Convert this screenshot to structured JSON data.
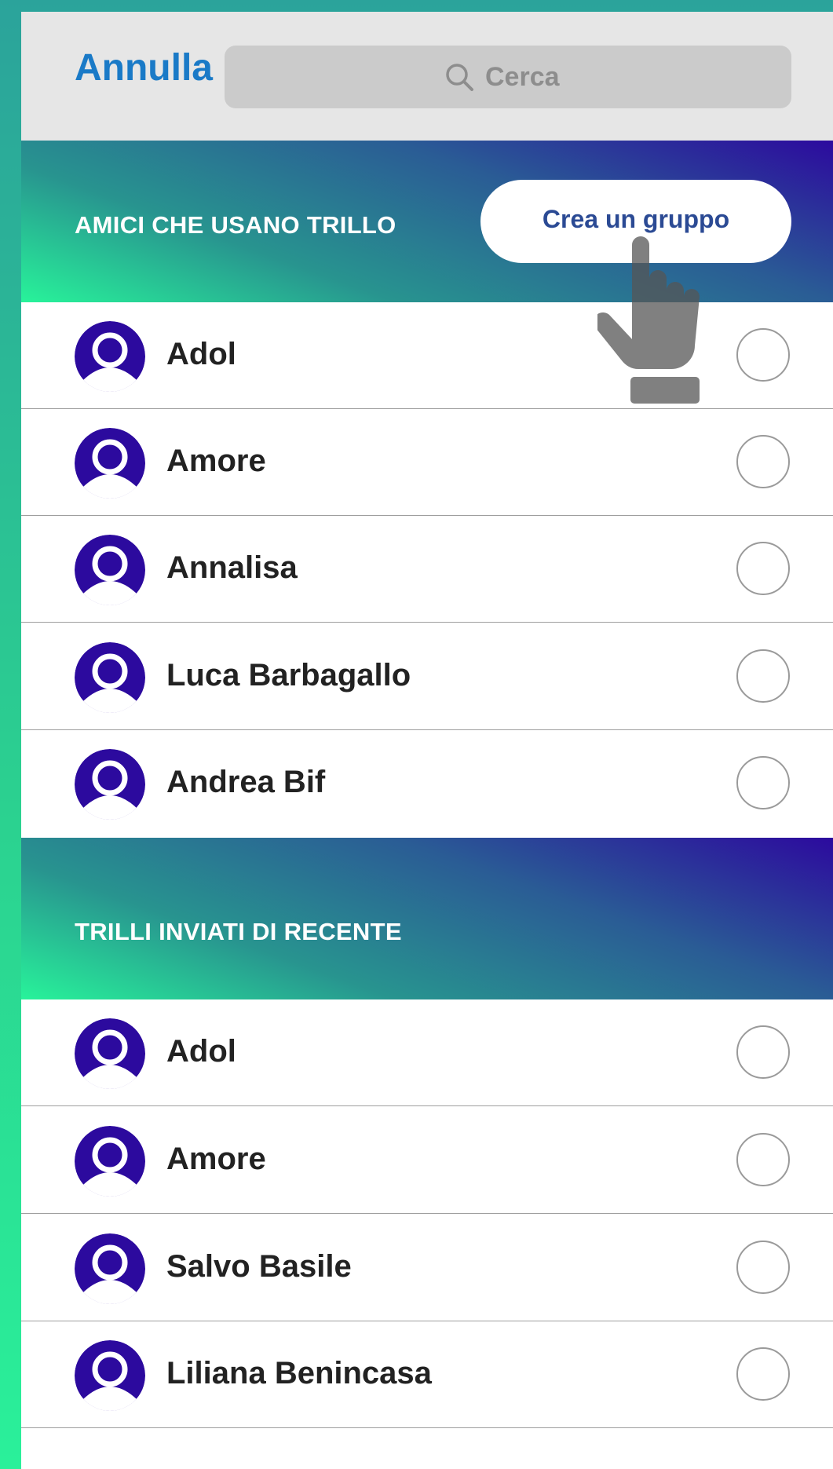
{
  "header": {
    "cancel_label": "Annulla",
    "search_placeholder": "Cerca"
  },
  "section_friends": {
    "title": "AMICI CHE USANO TRILLO",
    "create_group_label": "Crea un gruppo",
    "contacts": [
      {
        "name": "Adol"
      },
      {
        "name": "Amore"
      },
      {
        "name": "Annalisa"
      },
      {
        "name": "Luca Barbagallo"
      },
      {
        "name": "Andrea Bif"
      }
    ]
  },
  "section_recent": {
    "title": "TRILLI INVIATI DI RECENTE",
    "contacts": [
      {
        "name": "Adol"
      },
      {
        "name": "Amore"
      },
      {
        "name": "Salvo Basile"
      },
      {
        "name": "Liliana Benincasa"
      }
    ]
  },
  "colors": {
    "accent_blue": "#1a7ac7",
    "avatar_purple": "#2c0a9e",
    "gradient_green": "#28f39a"
  },
  "icons": {
    "search": "search-icon",
    "avatar": "user-avatar-icon",
    "pointer": "hand-pointer-icon"
  }
}
